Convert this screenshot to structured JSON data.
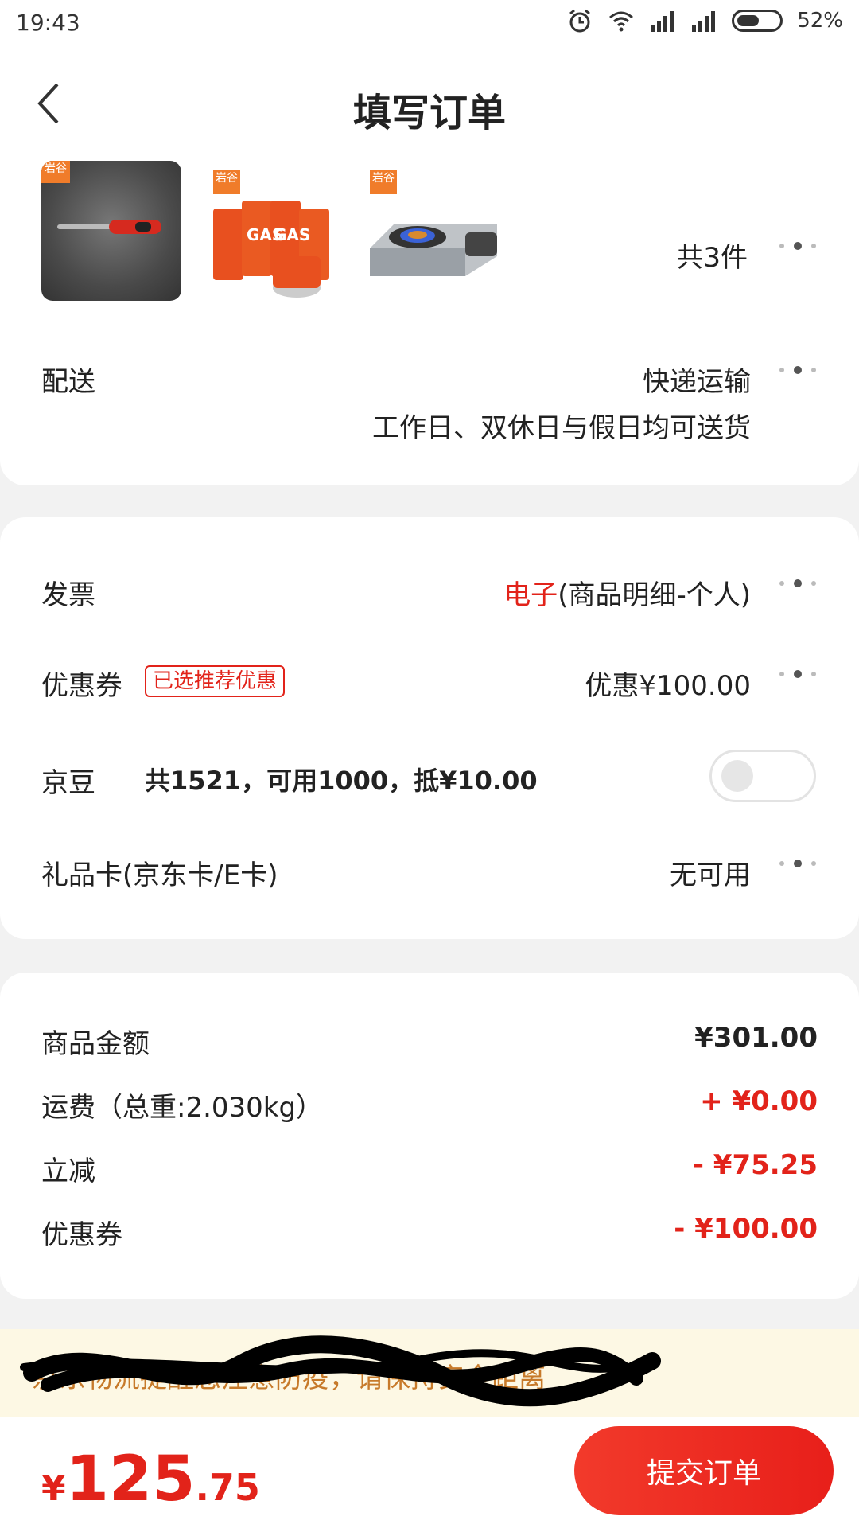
{
  "status_bar": {
    "time": "19:43",
    "battery": "52%",
    "battery_level": 0.52,
    "icons": [
      "alarm-icon",
      "wifi-icon",
      "signal-icon",
      "signal-icon",
      "battery-icon"
    ]
  },
  "header": {
    "title": "填写订单",
    "back_icon": "back-arrow-icon"
  },
  "products": {
    "brand_tag": "岩谷",
    "count_label": "共3件",
    "items": [
      {
        "name": "lighter-product-image"
      },
      {
        "name": "gas-cans-product-image",
        "label": "GAS"
      },
      {
        "name": "stove-product-image"
      }
    ]
  },
  "delivery": {
    "label": "配送",
    "method": "快递运输",
    "note": "工作日、双休日与假日均可送货"
  },
  "invoice": {
    "label": "发票",
    "type": "电子",
    "detail": "(商品明细-个人)"
  },
  "coupon": {
    "label": "优惠券",
    "badge": "已选推荐优惠",
    "value": "优惠¥100.00"
  },
  "jingdou": {
    "label": "京豆",
    "info": "共1521，可用1000，抵¥10.00",
    "enabled": false
  },
  "gift_card": {
    "label": "礼品卡(京东卡/E卡)",
    "value": "无可用"
  },
  "summary": {
    "items": [
      {
        "label": "商品金额",
        "value": "¥301.00",
        "color": "#222222"
      },
      {
        "label": "运费（总重:2.030kg）",
        "value": "+ ¥0.00",
        "color": "#e2231a"
      },
      {
        "label": "立减",
        "value": "- ¥75.25",
        "color": "#e2231a"
      },
      {
        "label": "优惠券",
        "value": "- ¥100.00",
        "color": "#e2231a"
      }
    ]
  },
  "notice": {
    "text": "京东物流提醒您注意防疫，请保持安全距离"
  },
  "footer": {
    "currency": "¥",
    "total_int": "125",
    "total_dec": ".75",
    "submit_label": "提交订单"
  },
  "colors": {
    "accent_red": "#e2231a",
    "notice_bg": "#fdf8e4",
    "notice_text": "#c77a2a"
  }
}
